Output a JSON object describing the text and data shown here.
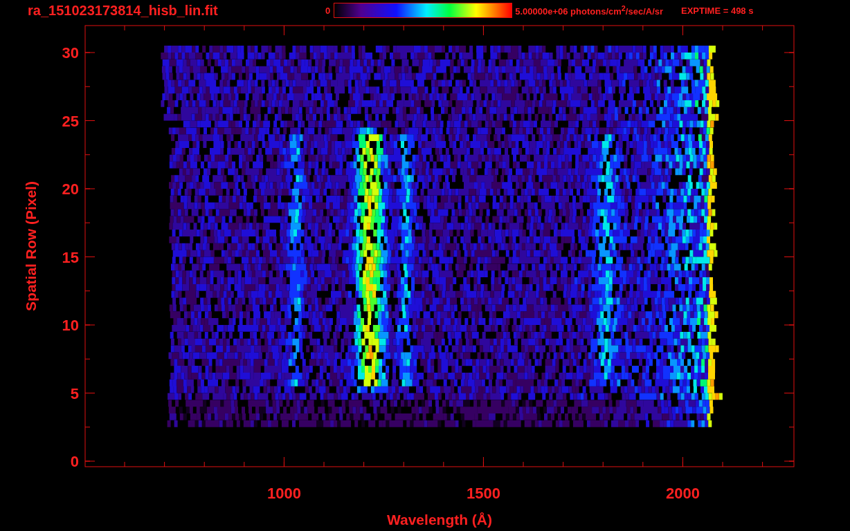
{
  "header": {
    "title": "ra_151023173814_hisb_lin.fit",
    "colorbar": {
      "min_label": "0",
      "max_label": "5.00000e+06 photons/cm$^{2}$/sec/A/sr"
    },
    "exposure": "EXPTIME = 498 s"
  },
  "plot": {
    "x_axis": {
      "label": "Wavelength (Å)",
      "ticks": [
        "1000",
        "1500",
        "2000"
      ]
    },
    "y_axis": {
      "label": "Spatial Row (Pixel)",
      "ticks": [
        "30",
        "25",
        "20",
        "15",
        "10",
        "5",
        "0"
      ]
    }
  }
}
